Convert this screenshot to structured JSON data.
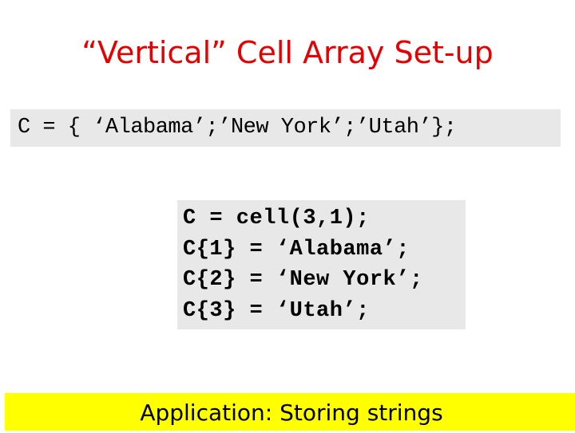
{
  "slide": {
    "title": "“Vertical” Cell Array Set-up",
    "title_color": "#e60000",
    "inline_code": "C = { ‘Alabama’;’New York’;’Utah’};",
    "code_block": [
      "C = cell(3,1);",
      "C{1} = ‘Alabama’;",
      "C{2} = ‘New York’;",
      "C{3} = ‘Utah’;"
    ],
    "code_background": "#e8e8e8",
    "banner_text": "Application: Storing strings",
    "banner_color": "#ffff00"
  }
}
